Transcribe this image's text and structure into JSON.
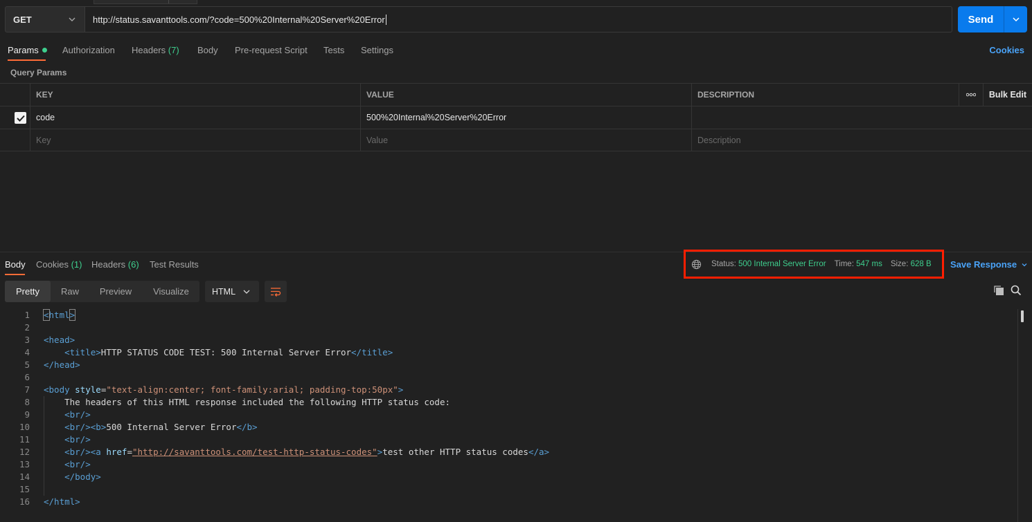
{
  "request": {
    "method": "GET",
    "url": "http://status.savanttools.com/?code=500%20Internal%20Server%20Error",
    "send_label": "Send"
  },
  "request_tabs": [
    {
      "label": "Params",
      "active": true,
      "dot": true
    },
    {
      "label": "Authorization"
    },
    {
      "label": "Headers",
      "count": "(7)"
    },
    {
      "label": "Body"
    },
    {
      "label": "Pre-request Script"
    },
    {
      "label": "Tests"
    },
    {
      "label": "Settings"
    }
  ],
  "cookies_link": "Cookies",
  "query_params": {
    "title": "Query Params",
    "columns": [
      "KEY",
      "VALUE",
      "DESCRIPTION"
    ],
    "bulk_edit": "Bulk Edit",
    "rows": [
      {
        "checked": true,
        "key": "code",
        "value": "500%20Internal%20Server%20Error",
        "description": ""
      }
    ],
    "placeholders": {
      "key": "Key",
      "value": "Value",
      "description": "Description"
    }
  },
  "response_tabs": [
    {
      "label": "Body",
      "active": true
    },
    {
      "label": "Cookies",
      "count": "(1)"
    },
    {
      "label": "Headers",
      "count": "(6)"
    },
    {
      "label": "Test Results"
    }
  ],
  "response_status": {
    "status_label": "Status:",
    "status_value": "500 Internal Server Error",
    "time_label": "Time:",
    "time_value": "547 ms",
    "size_label": "Size:",
    "size_value": "628 B",
    "highlight_color": "#ff1e00"
  },
  "save_response": "Save Response",
  "view_modes": [
    "Pretty",
    "Raw",
    "Preview",
    "Visualize"
  ],
  "active_view": "Pretty",
  "format": "HTML",
  "code_lines": [
    {
      "n": "1"
    },
    {
      "n": "2"
    },
    {
      "n": "3"
    },
    {
      "n": "4"
    },
    {
      "n": "5"
    },
    {
      "n": "6"
    },
    {
      "n": "7"
    },
    {
      "n": "8"
    },
    {
      "n": "9"
    },
    {
      "n": "10"
    },
    {
      "n": "11"
    },
    {
      "n": "12"
    },
    {
      "n": "13"
    },
    {
      "n": "14"
    },
    {
      "n": "15"
    },
    {
      "n": "16"
    }
  ],
  "code_text": {
    "title_text": "HTTP STATUS CODE TEST: 500 Internal Server Error",
    "body_style": "\"text-align:center; font-family:arial; padding-top:50px\"",
    "intro": "The headers of this HTML response included the following HTTP status code:",
    "bold_status": "500 Internal Server Error",
    "href": "\"http://savanttools.com/test-http-status-codes\"",
    "link_text": "test other HTTP status codes"
  },
  "colors": {
    "accent_blue": "#097bed",
    "tab_underline": "#ff6c37",
    "success_green": "#3ecf8e"
  }
}
